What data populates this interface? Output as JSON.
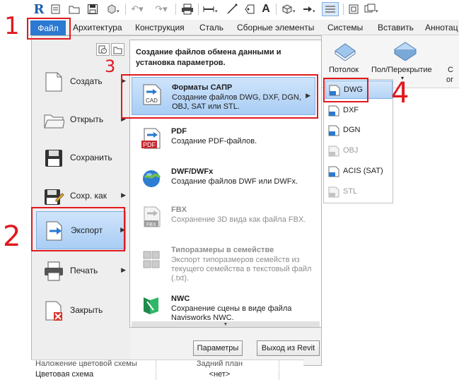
{
  "toolbar": {
    "logo": "R",
    "icons": [
      "open-file-icon",
      "save-icon",
      "sync-icon",
      "undo-icon",
      "redo-icon",
      "print-icon",
      "measure-icon",
      "dimension-icon",
      "text-annotation-icon",
      "3d-view-icon",
      "section-icon",
      "close-hidden-icon",
      "switch-windows-icon"
    ],
    "text_glyph": "A"
  },
  "tabs": {
    "file": "Файл",
    "items": [
      "Архитектура",
      "Конструкция",
      "Сталь",
      "Сборные элементы",
      "Системы",
      "Вставить",
      "Аннотац"
    ]
  },
  "ribbon": {
    "ceiling": "Потолок",
    "floor": "Пол/Перекрытие",
    "truncated": "С",
    "truncated2": "ог"
  },
  "appmenu": {
    "items": [
      {
        "label": "Создать",
        "icon": "new-document-icon",
        "has_arrow": true
      },
      {
        "label": "Открыть",
        "icon": "open-folder-icon",
        "has_arrow": true
      },
      {
        "label": "Сохранить",
        "icon": "save-disk-icon",
        "has_arrow": false
      },
      {
        "label": "Сохр. как",
        "icon": "save-as-icon",
        "has_arrow": true
      },
      {
        "label": "Экспорт",
        "icon": "export-icon",
        "has_arrow": true
      },
      {
        "label": "Печать",
        "icon": "printer-icon",
        "has_arrow": true
      },
      {
        "label": "Закрыть",
        "icon": "close-document-icon",
        "has_arrow": false
      }
    ],
    "active": "Экспорт"
  },
  "submenu": {
    "header": "Создание файлов обмена данными и установка параметров.",
    "items": [
      {
        "title": "Форматы САПР",
        "desc": "Создание файлов DWG, DXF, DGN, OBJ, SAT или STL.",
        "icon": "cad-icon",
        "icon_text": "CAD",
        "active": true,
        "disabled": false
      },
      {
        "title": "PDF",
        "desc": "Создание PDF-файлов.",
        "icon": "pdf-icon",
        "icon_text": "PDF",
        "active": false,
        "disabled": false
      },
      {
        "title": "DWF/DWFx",
        "desc": "Создание файлов DWF или DWFx.",
        "icon": "dwf-globe-icon",
        "icon_text": "",
        "active": false,
        "disabled": false
      },
      {
        "title": "FBX",
        "desc": "Сохранение 3D вида как файла FBX.",
        "icon": "fbx-icon",
        "icon_text": "FBX",
        "active": false,
        "disabled": true
      },
      {
        "title": "Типоразмеры в семействе",
        "desc": "Экспорт типоразмеров семейств из текущего семейства в текстовый файл (.txt).",
        "icon": "family-types-icon",
        "icon_text": "",
        "active": false,
        "disabled": true
      },
      {
        "title": "NWC",
        "desc": "Сохранение сцены в виде файла Navisworks NWC.",
        "icon": "navisworks-icon",
        "icon_text": "",
        "active": false,
        "disabled": false
      }
    ],
    "options_button": "Параметры",
    "exit_button": "Выход из Revit"
  },
  "flyout": {
    "items": [
      {
        "label": "DWG",
        "active": true,
        "disabled": false
      },
      {
        "label": "DXF",
        "active": false,
        "disabled": false
      },
      {
        "label": "DGN",
        "active": false,
        "disabled": false
      },
      {
        "label": "OBJ",
        "active": false,
        "disabled": true
      },
      {
        "label": "ACIS (SAT)",
        "active": false,
        "disabled": false
      },
      {
        "label": "STL",
        "active": false,
        "disabled": true
      }
    ]
  },
  "properties": {
    "row1": [
      "Наложение цветовой схемы",
      "Задний план"
    ],
    "row2": [
      "Цветовая схема",
      "<нет>"
    ]
  },
  "annotations": [
    "1",
    "2",
    "3",
    "4"
  ],
  "colors": {
    "accent": "#2b79d0",
    "highlight": "#a9cdf4",
    "annotation": "#e0191f"
  }
}
